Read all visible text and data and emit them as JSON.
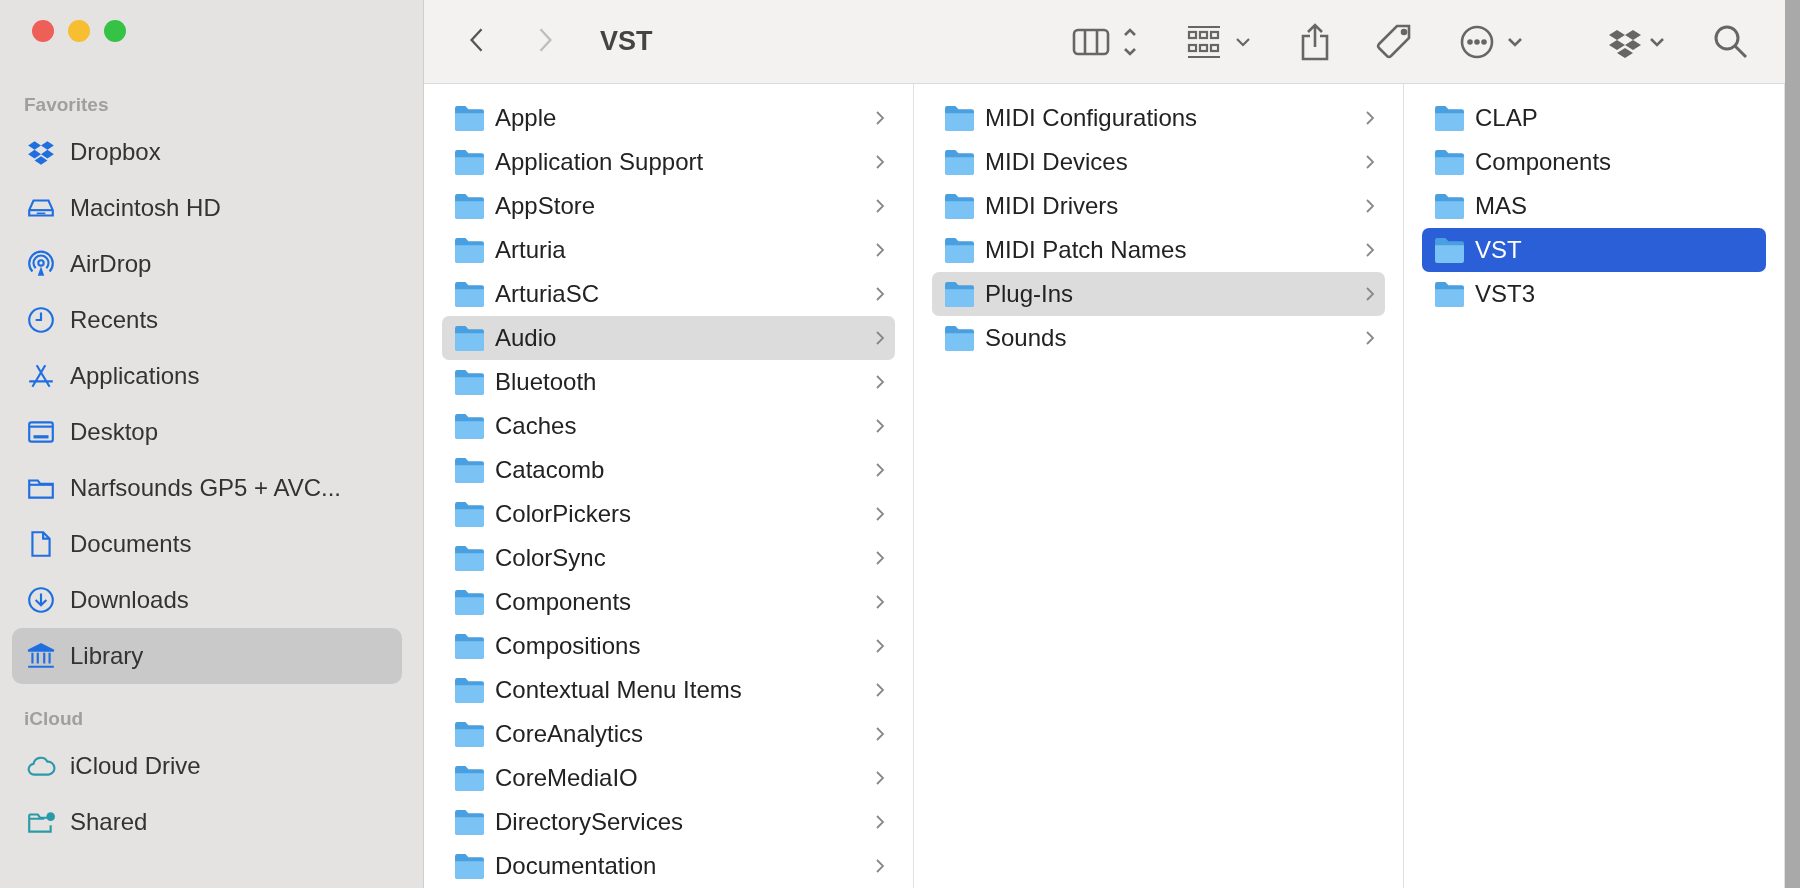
{
  "window": {
    "title": "VST"
  },
  "navigation": [
    {
      "kind": "back",
      "disabled": false
    },
    {
      "kind": "forward",
      "disabled": true
    }
  ],
  "sidebar": {
    "sections": [
      {
        "title": "Favorites",
        "items": [
          {
            "label": "Dropbox",
            "kind": "dropbox",
            "selected": false
          },
          {
            "label": "Macintosh HD",
            "kind": "drive",
            "selected": false
          },
          {
            "label": "AirDrop",
            "kind": "airdrop",
            "selected": false
          },
          {
            "label": "Recents",
            "kind": "clock",
            "selected": false
          },
          {
            "label": "Applications",
            "kind": "apps",
            "selected": false
          },
          {
            "label": "Desktop",
            "kind": "desktop",
            "selected": false
          },
          {
            "label": "Narfsounds GP5 + AVC...",
            "kind": "folder",
            "selected": false
          },
          {
            "label": "Documents",
            "kind": "document",
            "selected": false
          },
          {
            "label": "Downloads",
            "kind": "download",
            "selected": false
          },
          {
            "label": "Library",
            "kind": "library",
            "selected": true
          }
        ]
      },
      {
        "title": "iCloud",
        "items": [
          {
            "label": "iCloud Drive",
            "kind": "cloud",
            "selected": false
          },
          {
            "label": "Shared",
            "kind": "shared",
            "selected": false
          }
        ]
      }
    ]
  },
  "columns": [
    {
      "focused": false,
      "items": [
        {
          "name": "Apple",
          "selected": false,
          "expandable": true
        },
        {
          "name": "Application Support",
          "selected": false,
          "expandable": true
        },
        {
          "name": "AppStore",
          "selected": false,
          "expandable": true
        },
        {
          "name": "Arturia",
          "selected": false,
          "expandable": true
        },
        {
          "name": "ArturiaSC",
          "selected": false,
          "expandable": true
        },
        {
          "name": "Audio",
          "selected": true,
          "expandable": true
        },
        {
          "name": "Bluetooth",
          "selected": false,
          "expandable": true
        },
        {
          "name": "Caches",
          "selected": false,
          "expandable": true
        },
        {
          "name": "Catacomb",
          "selected": false,
          "expandable": true
        },
        {
          "name": "ColorPickers",
          "selected": false,
          "expandable": true
        },
        {
          "name": "ColorSync",
          "selected": false,
          "expandable": true
        },
        {
          "name": "Components",
          "selected": false,
          "expandable": true
        },
        {
          "name": "Compositions",
          "selected": false,
          "expandable": true
        },
        {
          "name": "Contextual Menu Items",
          "selected": false,
          "expandable": true
        },
        {
          "name": "CoreAnalytics",
          "selected": false,
          "expandable": true
        },
        {
          "name": "CoreMediaIO",
          "selected": false,
          "expandable": true
        },
        {
          "name": "DirectoryServices",
          "selected": false,
          "expandable": true
        },
        {
          "name": "Documentation",
          "selected": false,
          "expandable": true
        }
      ]
    },
    {
      "focused": false,
      "items": [
        {
          "name": "MIDI Configurations",
          "selected": false,
          "expandable": true
        },
        {
          "name": "MIDI Devices",
          "selected": false,
          "expandable": true
        },
        {
          "name": "MIDI Drivers",
          "selected": false,
          "expandable": true
        },
        {
          "name": "MIDI Patch Names",
          "selected": false,
          "expandable": true
        },
        {
          "name": "Plug-Ins",
          "selected": true,
          "expandable": true
        },
        {
          "name": "Sounds",
          "selected": false,
          "expandable": true
        }
      ]
    },
    {
      "focused": true,
      "items": [
        {
          "name": "CLAP",
          "selected": false,
          "expandable": false
        },
        {
          "name": "Components",
          "selected": false,
          "expandable": false
        },
        {
          "name": "MAS",
          "selected": false,
          "expandable": false
        },
        {
          "name": "VST",
          "selected": true,
          "expandable": false
        },
        {
          "name": "VST3",
          "selected": false,
          "expandable": false
        }
      ]
    }
  ]
}
